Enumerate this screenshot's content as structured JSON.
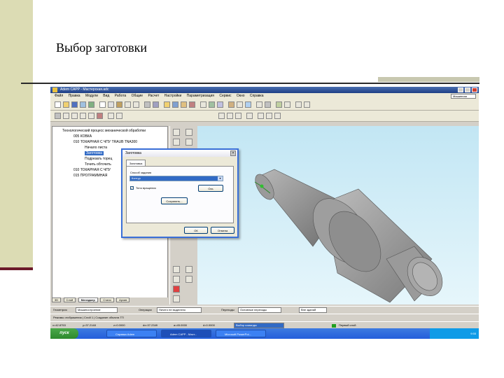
{
  "slide": {
    "title": "Выбор заготовки",
    "colors": {
      "left_band": "#dcdcb4",
      "left_accent": "#6b1a2a",
      "rule": "#2a2a2a"
    }
  },
  "app": {
    "window_title": "Adem CAPP - Мастерская.adc",
    "menu": [
      "Файл",
      "Правка",
      "Модули",
      "Вид",
      "Работа",
      "Общие",
      "Расчет",
      "Настройки",
      "Параметризация",
      "Сервис",
      "Окно",
      "Справка"
    ],
    "menu_right_select": "Машинная",
    "tree": [
      {
        "label": "Технологический процесс механической обработки",
        "selected": false
      },
      {
        "label": "005 КОВКА",
        "selected": false
      },
      {
        "label": "010 ТОКАРНАЯ С ЧПУ TRAUB TNA300",
        "selected": false
      },
      {
        "label": "Начало листа",
        "selected": false
      },
      {
        "label": "Заготовка",
        "selected": true
      },
      {
        "label": "Подрезать торец",
        "selected": false
      },
      {
        "label": "Точить обточить",
        "selected": false
      },
      {
        "label": "010 ТОКАРНАЯ С ЧПУ",
        "selected": false
      },
      {
        "label": "015 ПРОГРАММНАЯ",
        "selected": false
      }
    ],
    "panel_tabs": [
      "3D",
      "Слой",
      "Менеджер",
      "Стили",
      "Архив"
    ],
    "status1": {
      "field1_label": "Геометрия",
      "field1_value": "Машиностроение",
      "operations_label": "Операции",
      "operations_value": "Ничего не выделено",
      "transitions_label": "Переходы",
      "transitions_value": "Основные переходы",
      "field4_value": "Вне зданий"
    },
    "status2": "Режимы отображения  |  Слой 1  |  Создание объекта ТП",
    "coords": {
      "x": "x=42.8753",
      "y": "y=37.2148",
      "z": "z=0.0000",
      "dx": "dx=37.2349",
      "a": "a=45.0000",
      "d": "d=0.0000",
      "hint": "Выбор команды",
      "layer": "Первый слой"
    },
    "taskbar": {
      "start": "пуск",
      "buttons": [
        "Справка Adem",
        "Adem CAPP - Маст...",
        "Microsoft PowerPoi..."
      ],
      "clock": "9:55"
    }
  },
  "dialog": {
    "title": "Заготовка",
    "close": "×",
    "tab": "Заготовка",
    "method_label": "Способ задания",
    "method_value": "Контур",
    "checkbox_label": "Тело вращения",
    "checkbox_checked": "✓",
    "axis_button": "Ось",
    "save_button": "Сохранить...",
    "ok_button": "ОК",
    "cancel_button": "Отмена"
  }
}
